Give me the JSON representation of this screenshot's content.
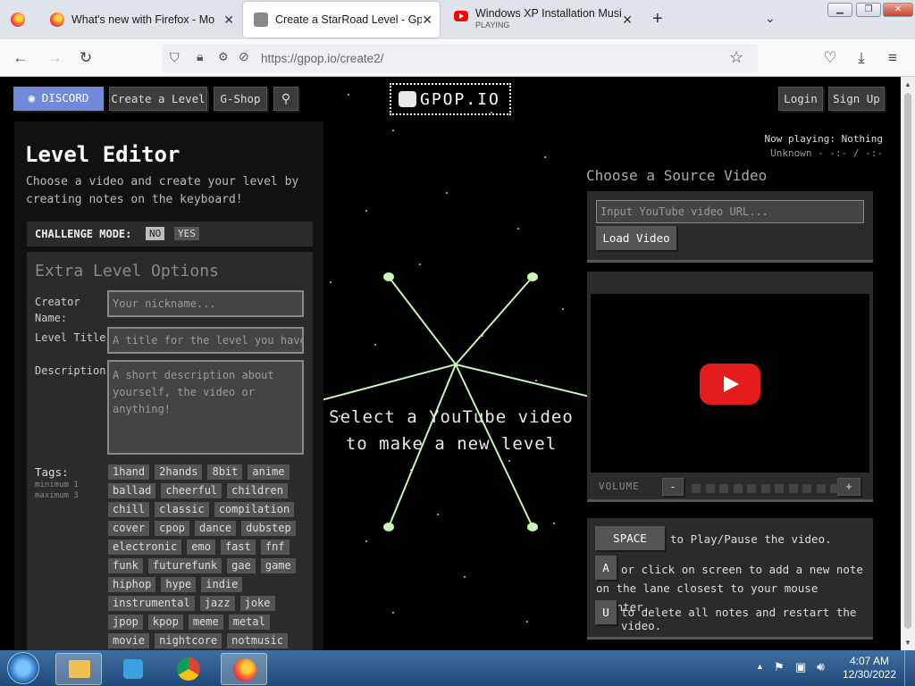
{
  "browser": {
    "tabs": [
      {
        "label": "What's new with Firefox - More"
      },
      {
        "label": "Create a StarRoad Level - Gpop"
      },
      {
        "label": "Windows XP Installation Music",
        "sub": "PLAYING"
      }
    ],
    "new_tab": "+",
    "url": "https://gpop.io/create2/"
  },
  "site": {
    "nav": {
      "discord": "DISCORD",
      "create": "Create a Level",
      "shop": "G-Shop",
      "login": "Login",
      "signup": "Sign Up"
    },
    "logo": "GPOP.IO",
    "now_playing": "Now playing: Nothing",
    "unknown": "Unknown - -:- / -:-",
    "title": "Level Editor",
    "subtitle": "Choose a video and create your level by creating notes on the keyboard!",
    "challenge": {
      "label": "CHALLENGE MODE:",
      "no": "NO",
      "yes": "YES"
    },
    "extra": "Extra Level Options",
    "creator_label": "Creator Name:",
    "creator_ph": "Your nickname...",
    "level_label": "Level Title:",
    "level_ph": "A title for the level you have cr",
    "desc_label": "Description:",
    "desc_ph": "A short description about yourself, the video or anything!",
    "tags_label": "Tags:",
    "tags_min": "minimum 1",
    "tags_max": "maximum 3",
    "tags": [
      [
        "1hand",
        "2hands",
        "8bit",
        "anime"
      ],
      [
        "ballad",
        "cheerful",
        "children"
      ],
      [
        "chill",
        "classic",
        "compilation"
      ],
      [
        "cover",
        "cpop",
        "dance",
        "dubstep"
      ],
      [
        "electronic",
        "emo",
        "fast",
        "fnf"
      ],
      [
        "funk",
        "futurefunk",
        "gae",
        "game"
      ],
      [
        "hiphop",
        "hype",
        "indie"
      ],
      [
        "instrumental",
        "jazz",
        "joke"
      ],
      [
        "jpop",
        "kpop",
        "meme",
        "metal"
      ],
      [
        "movie",
        "nightcore",
        "notmusic"
      ]
    ],
    "center_text": "Select a YouTube video to make a new level",
    "source_title": "Choose a Source Video",
    "yt_ph": "Input YouTube video URL...",
    "load": "Load Video",
    "volume": "VOLUME",
    "vol_minus": "-",
    "vol_plus": "+",
    "help": [
      {
        "key": "SPACE",
        "text": "to Play/Pause the video."
      },
      {
        "key": "A",
        "text": "or click on screen to add a new note on the lane closest to your mouse pointer."
      },
      {
        "key": "U",
        "text": "to delete all notes and restart the video."
      }
    ]
  },
  "taskbar": {
    "time": "4:07 AM",
    "date": "12/30/2022"
  }
}
